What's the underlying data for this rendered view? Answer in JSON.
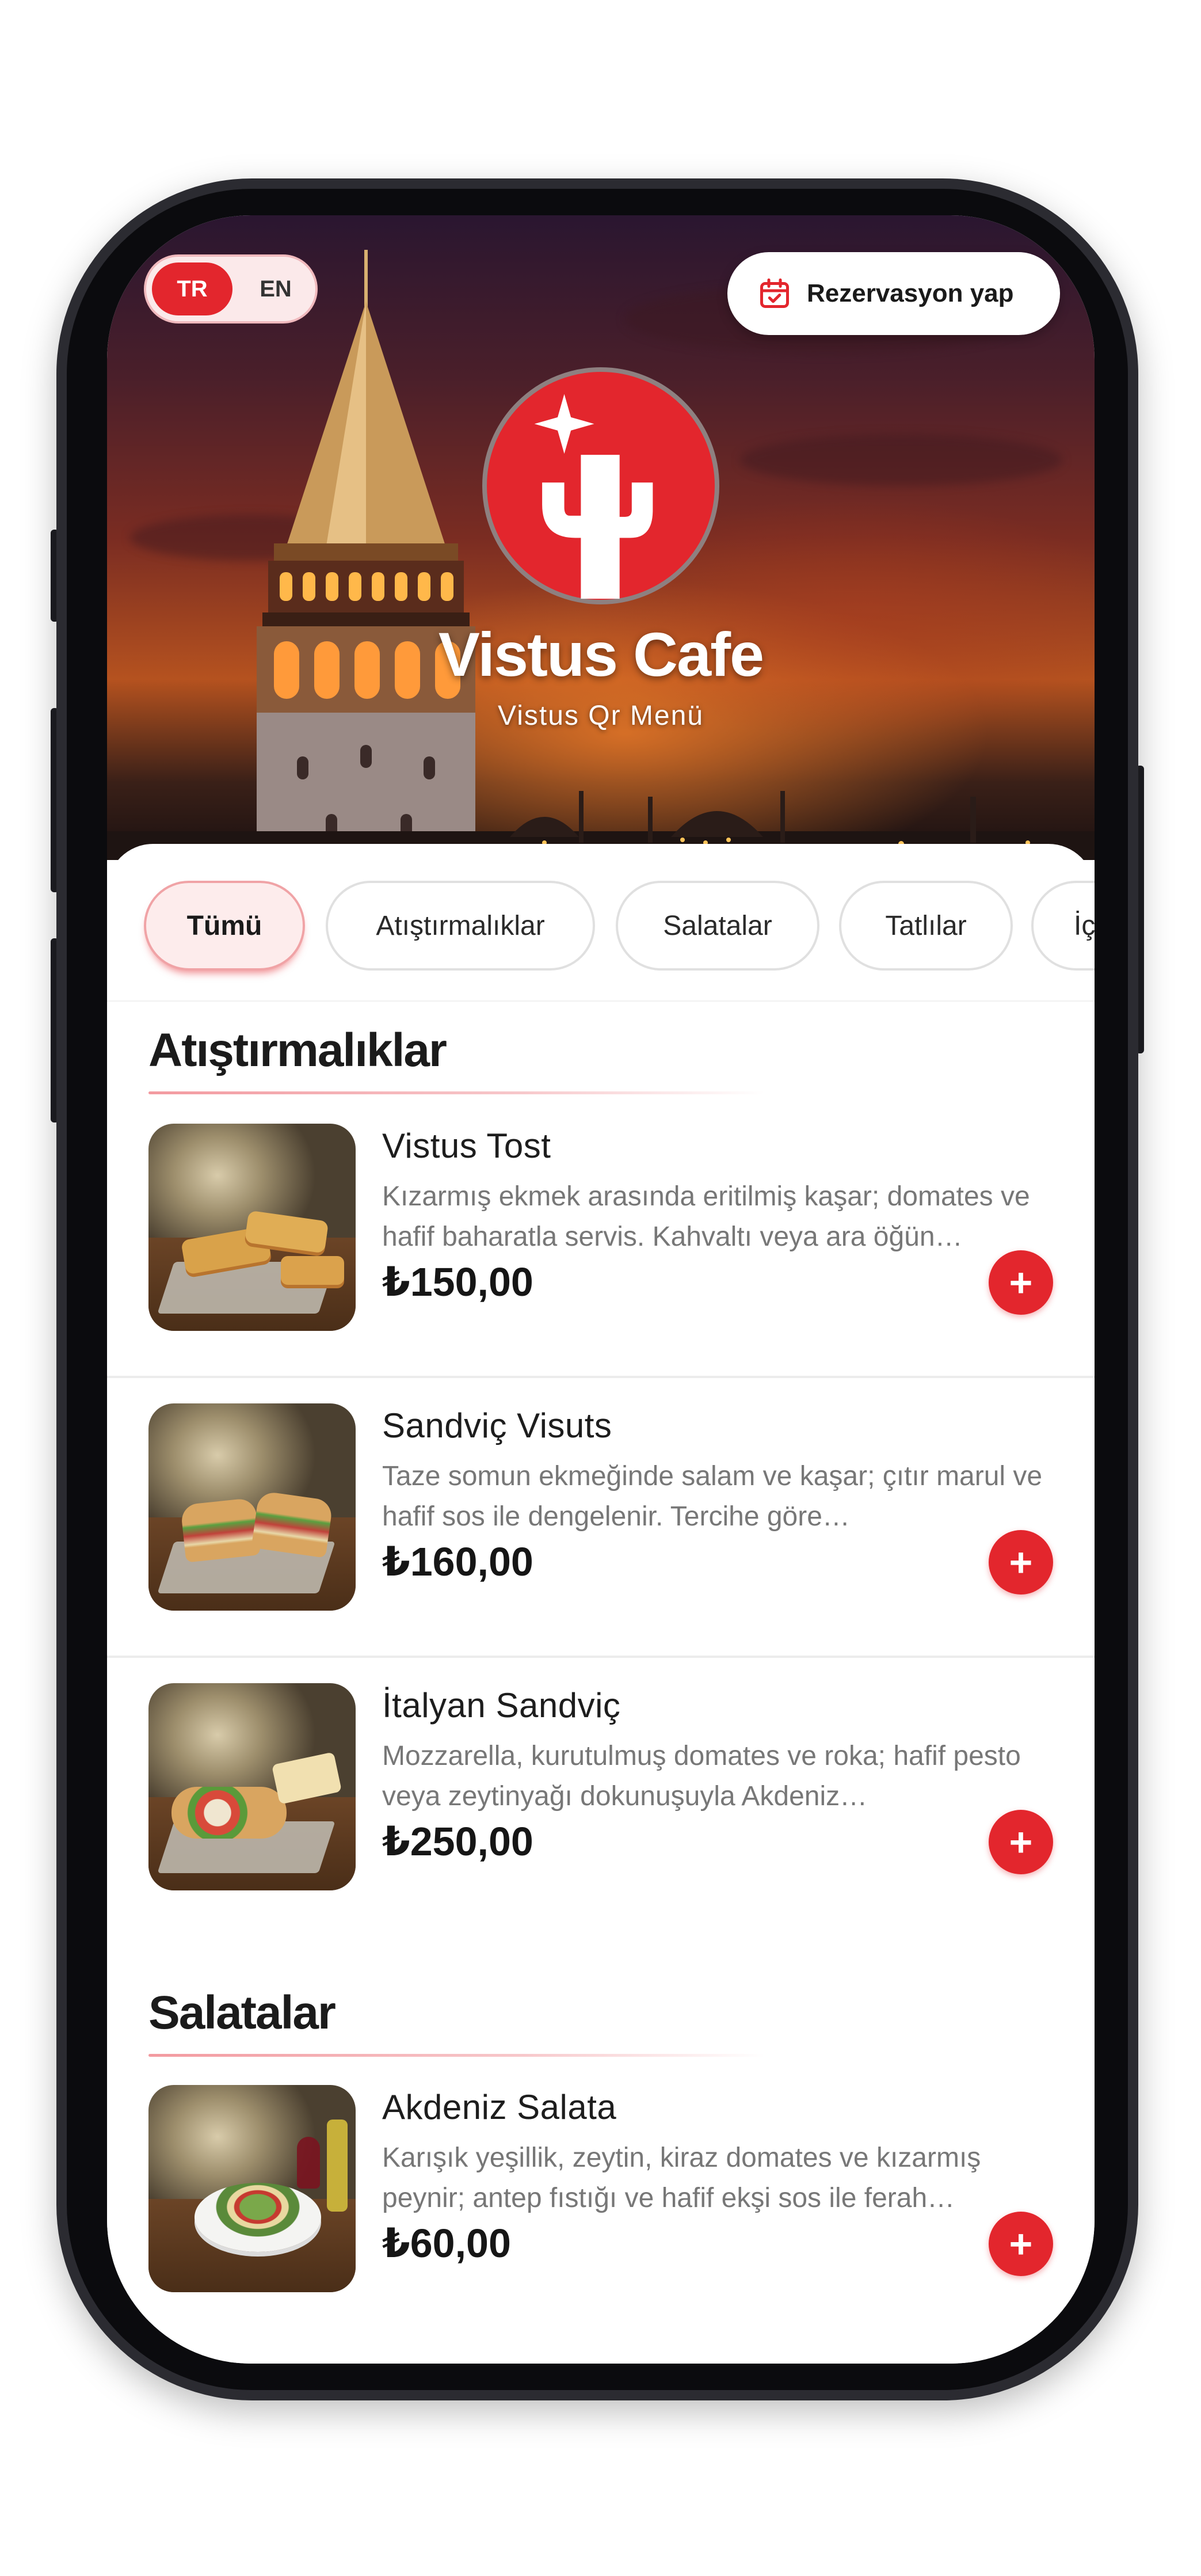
{
  "language_toggle": {
    "active": "TR",
    "inactive": "EN"
  },
  "header": {
    "reservation_label": "Rezervasyon yap",
    "cafe_name": "Vistus Cafe",
    "subtitle": "Vistus Qr Menü"
  },
  "tabs": [
    {
      "label": "Tümü",
      "active": true
    },
    {
      "label": "Atıştırmalıklar",
      "active": false
    },
    {
      "label": "Salatalar",
      "active": false
    },
    {
      "label": "Tatlılar",
      "active": false
    },
    {
      "label": "İç",
      "active": false
    }
  ],
  "sections": [
    {
      "title": "Atıştırmalıklar",
      "items": [
        {
          "name": "Vistus Tost",
          "description": "Kızarmış ekmek arasında eritilmiş kaşar; domates ve hafif baharatla servis. Kahvaltı veya ara öğün…",
          "price": "₺150,00"
        },
        {
          "name": "Sandviç Visuts",
          "description": "Taze somun ekmeğinde salam ve kaşar; çıtır marul ve hafif sos ile dengelenir. Tercihe göre…",
          "price": "₺160,00"
        },
        {
          "name": "İtalyan Sandviç",
          "description": "Mozzarella, kurutulmuş domates ve roka; hafif pesto veya zeytinyağı dokunuşuyla Akdeniz…",
          "price": "₺250,00"
        }
      ]
    },
    {
      "title": "Salatalar",
      "items": [
        {
          "name": "Akdeniz Salata",
          "description": "Karışık yeşillik, zeytin, kiraz domates ve kızarmış peynir; antep fıstığı ve hafif ekşi sos ile ferah…",
          "price": "₺60,00"
        }
      ]
    }
  ],
  "add_button_symbol": "+",
  "colors": {
    "accent": "#e3262d",
    "accent_soft": "#fdecec",
    "text": "#1b1b1b",
    "muted": "#777777"
  },
  "icons": [
    "calendar-check-icon",
    "cactus-logo-icon",
    "plus-icon"
  ]
}
